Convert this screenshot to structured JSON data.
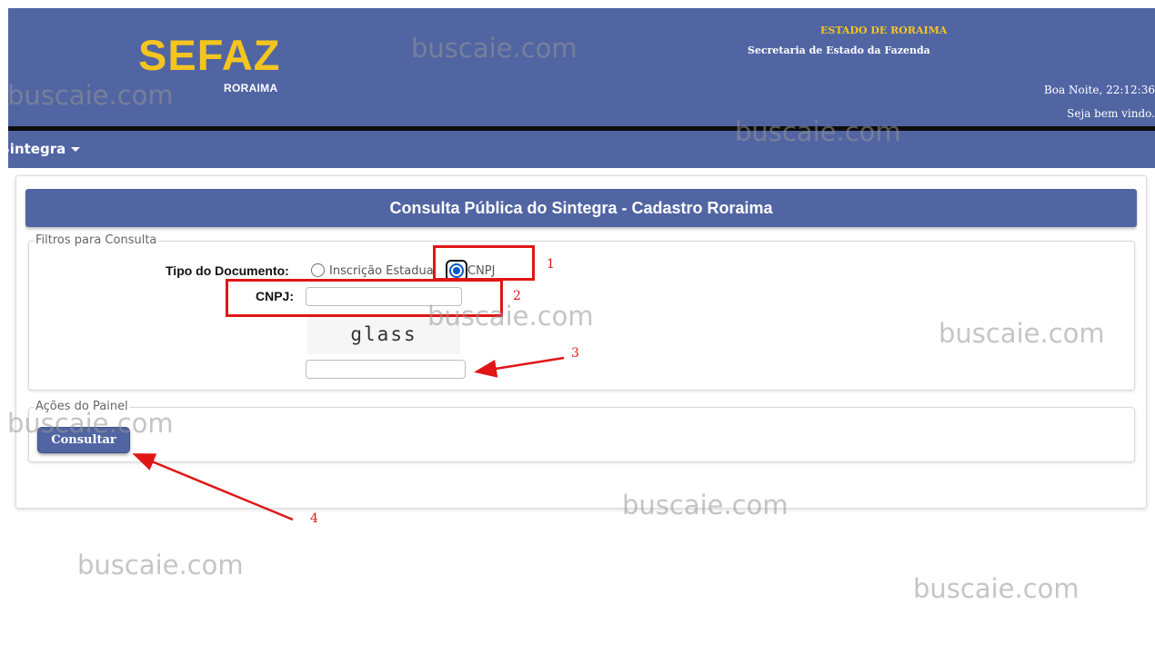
{
  "header": {
    "logo_text": "SEFAZ",
    "logo_subtext": "RORAIMA",
    "state_name": "ESTADO DE RORAIMA",
    "secretaria": "Secretaria de Estado da Fazenda",
    "greeting": "Boa Noite, 22:12:36",
    "welcome": "Seja bem vindo.",
    "colors": {
      "bar": "#5165a3",
      "accent": "#f4c51f"
    }
  },
  "nav": {
    "menu_label": "Sintegra"
  },
  "page": {
    "title": "Consulta Pública do Sintegra - Cadastro Roraima"
  },
  "filters": {
    "legend": "Filtros para Consulta",
    "tipo_label": "Tipo do Documento:",
    "options": [
      {
        "label": "Inscrição Estadual",
        "selected": false
      },
      {
        "label": "CNPJ",
        "selected": true
      }
    ],
    "cnpj_label": "CNPJ:",
    "cnpj_value": "",
    "captcha_text": "glass",
    "captcha_value": ""
  },
  "actions": {
    "legend": "Ações do Painel",
    "consultar_label": "Consultar"
  },
  "annotations": {
    "labels": [
      "1",
      "2",
      "3",
      "4"
    ],
    "color": "#e01616"
  },
  "watermark": "buscaie.com"
}
